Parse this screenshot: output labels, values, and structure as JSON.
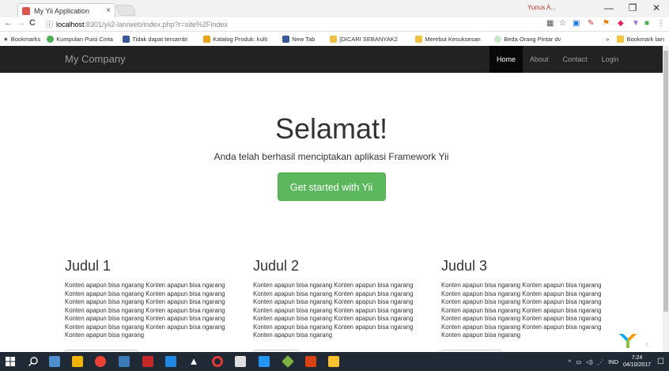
{
  "browser": {
    "tab_title": "My Yii Application",
    "tab_close": "×",
    "profile_name": "Yunus A...",
    "window_controls": {
      "minimize": "—",
      "maximize": "❐",
      "close": "✕"
    },
    "nav": {
      "back": "←",
      "forward": "→",
      "reload": "C"
    },
    "address": {
      "info_icon": "ⓘ",
      "host": "localhost",
      "path": ":8301/yii2-lan/web/index.php?r=site%2Findex"
    },
    "bookmarks_label": "Bookmarks",
    "bookmarks": [
      {
        "label": "Kumpulan Puisi Cinta",
        "icon_color": "#4caf50"
      },
      {
        "label": "Tidak dapat tersambi",
        "icon_color": "#3b5998"
      },
      {
        "label": "Katalog Produk: kulit",
        "icon_color": "#e8a317"
      },
      {
        "label": "New Tab",
        "icon_color": "#3b5998"
      },
      {
        "label": "[DICARI SEBANYAK2",
        "icon_color": "#f0c040"
      },
      {
        "label": "Merebut Kesuksesan",
        "icon_color": "#f0c040"
      },
      {
        "label": "Beda Orang Pintar dv",
        "icon_color": "#c8e6c9"
      }
    ],
    "bookmarks_overflow": "»",
    "other_bookmarks": "Bookmark lain"
  },
  "site": {
    "brand": "My Company",
    "nav": [
      {
        "label": "Home",
        "active": true
      },
      {
        "label": "About",
        "active": false
      },
      {
        "label": "Contact",
        "active": false
      },
      {
        "label": "Login",
        "active": false
      }
    ],
    "jumbotron": {
      "title": "Selamat!",
      "lead": "Anda telah berhasil menciptakan aplikasi Framework Yii",
      "button": "Get started with Yii"
    },
    "columns": [
      {
        "title": "Judul 1",
        "body": "Konten apapun bisa ngarang Konten apapun bisa ngarang Konten apapun bisa ngarang Konten apapun bisa ngarang Konten apapun bisa ngarang Konten apapun bisa ngarang Konten apapun bisa ngarang Konten apapun bisa ngarang Konten apapun bisa ngarang Konten apapun bisa ngarang Konten apapun bisa ngarang Konten apapun bisa ngarang Konten apapun bisa ngarang"
      },
      {
        "title": "Judul 2",
        "body": "Konten apapun bisa ngarang Konten apapun bisa ngarang Konten apapun bisa ngarang Konten apapun bisa ngarang Konten apapun bisa ngarang Konten apapun bisa ngarang Konten apapun bisa ngarang Konten apapun bisa ngarang Konten apapun bisa ngarang Konten apapun bisa ngarang Konten apapun bisa ngarang Konten apapun bisa ngarang Konten apapun bisa ngarang"
      },
      {
        "title": "Judul 3",
        "body": "Konten apapun bisa ngarang Konten apapun bisa ngarang Konten apapun bisa ngarang Konten apapun bisa ngarang Konten apapun bisa ngarang Konten apapun bisa ngarang Konten apapun bisa ngarang Konten apapun bisa ngarang Konten apapun bisa ngarang Konten apapun bisa ngarang Konten apapun bisa ngarang Konten apapun bisa ngarang Konten apapun bisa ngarang"
      }
    ]
  },
  "taskbar": {
    "language": "IND",
    "time": "7:24",
    "date": "04/10/2017"
  },
  "colors": {
    "navbar_bg": "#222222",
    "primary_button": "#5cb85c",
    "taskbar_bg": "#1f2a36"
  }
}
